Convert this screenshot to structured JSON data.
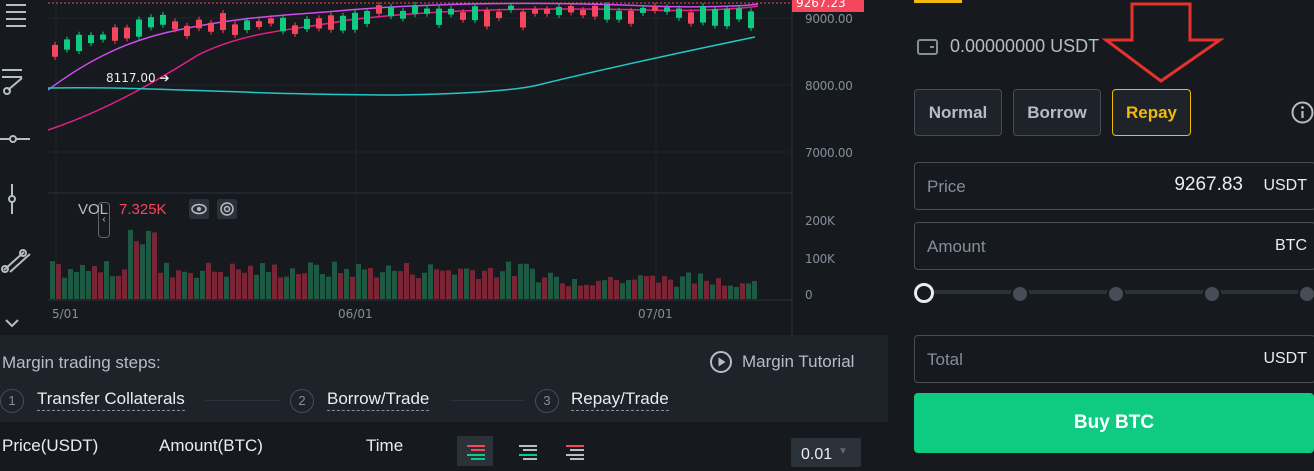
{
  "chart": {
    "price_ticks": [
      "9000.00",
      "8000.00",
      "7000.00"
    ],
    "last_price": "9267.23",
    "annotation": "8117.00",
    "vol_label": "VOL",
    "vol_value": "7.325K",
    "vol_ticks": [
      "200K",
      "100K",
      "0"
    ],
    "date_ticks": [
      "5/01",
      "06/01",
      "07/01"
    ],
    "colors": {
      "up": "#0ecb81",
      "down": "#f6465d",
      "ma1": "#e91e8c",
      "ma2": "#d14cf0",
      "ma3": "#26c6c6"
    }
  },
  "bottom": {
    "steps_title": "Margin trading steps:",
    "tutorial_label": "Margin Tutorial",
    "steps": [
      {
        "num": "1",
        "label": "Transfer Collaterals"
      },
      {
        "num": "2",
        "label": "Borrow/Trade"
      },
      {
        "num": "3",
        "label": "Repay/Trade"
      }
    ],
    "columns": [
      "Price(USDT)",
      "Amount(BTC)",
      "Time"
    ],
    "precision": "0.01"
  },
  "order": {
    "balance": "0.00000000 USDT",
    "modes": [
      "Normal",
      "Borrow",
      "Repay"
    ],
    "active_mode": "Repay",
    "price_label": "Price",
    "price_value": "9267.83",
    "price_unit": "USDT",
    "amount_label": "Amount",
    "amount_unit": "BTC",
    "total_label": "Total",
    "total_unit": "USDT",
    "buy_label": "Buy BTC",
    "slider_percent": 0
  }
}
